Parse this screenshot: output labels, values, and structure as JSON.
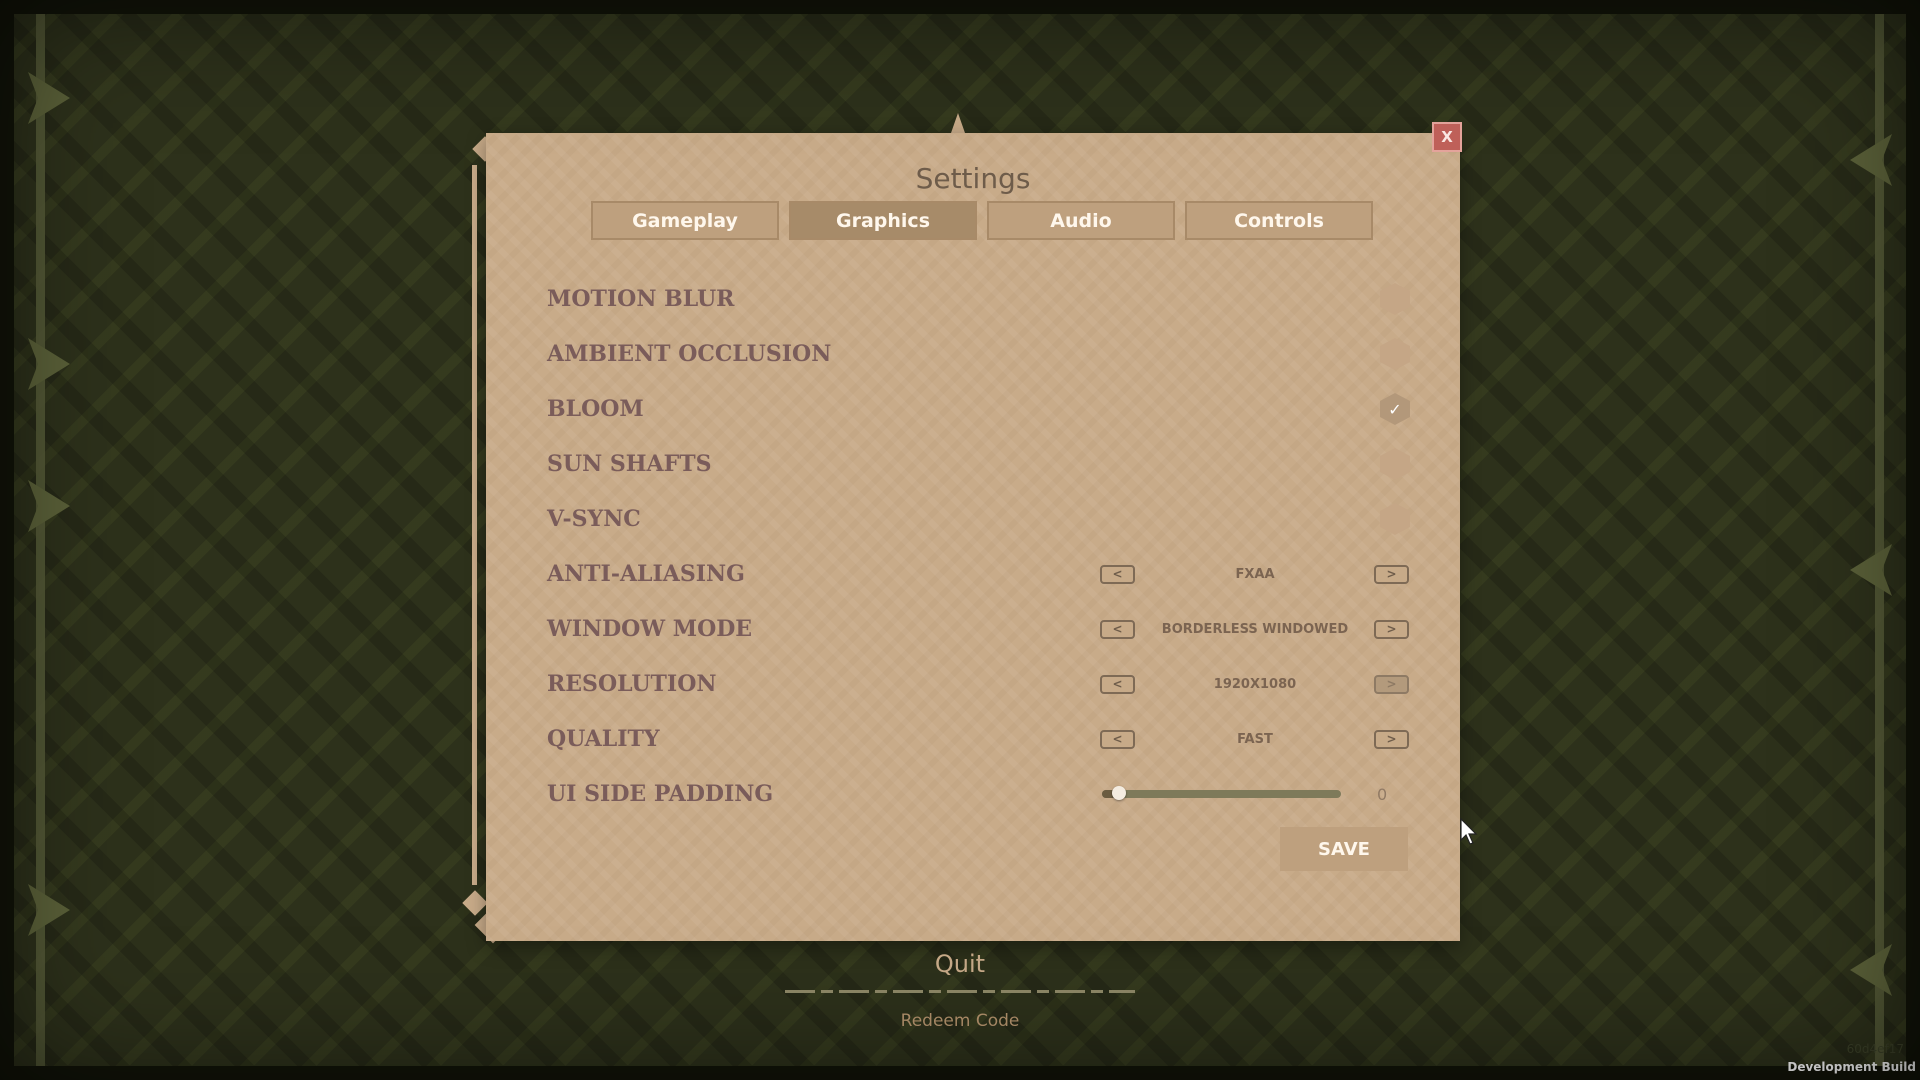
{
  "dialog": {
    "title": "Settings",
    "close_label": "X",
    "tabs": [
      {
        "label": "Gameplay",
        "active": false
      },
      {
        "label": "Graphics",
        "active": true
      },
      {
        "label": "Audio",
        "active": false
      },
      {
        "label": "Controls",
        "active": false
      }
    ],
    "toggles": [
      {
        "label": "MOTION BLUR",
        "checked": false
      },
      {
        "label": "AMBIENT OCCLUSION",
        "checked": false
      },
      {
        "label": "BLOOM",
        "checked": true
      },
      {
        "label": "SUN SHAFTS",
        "checked": false
      },
      {
        "label": "V-SYNC",
        "checked": false
      }
    ],
    "selectors": [
      {
        "label": "ANTI-ALIASING",
        "value": "FXAA",
        "prev": "<",
        "next": ">",
        "next_disabled": false
      },
      {
        "label": "WINDOW MODE",
        "value": "BORDERLESS WINDOWED",
        "prev": "<",
        "next": ">",
        "next_disabled": false
      },
      {
        "label": "RESOLUTION",
        "value": "1920X1080",
        "prev": "<",
        "next": ">",
        "next_disabled": true
      },
      {
        "label": "QUALITY",
        "value": "FAST",
        "prev": "<",
        "next": ">",
        "next_disabled": false
      }
    ],
    "slider": {
      "label": "UI SIDE PADDING",
      "value": "0",
      "fraction": 0.0
    },
    "save_label": "SAVE"
  },
  "menu": {
    "quit_label": "Quit",
    "redeem_label": "Redeem Code"
  },
  "footer": {
    "build_hash": "60d4ef17",
    "dev_build": "Development Build"
  },
  "icons": {
    "check": "check-icon",
    "close": "close-icon",
    "cursor": "mouse-cursor-icon"
  },
  "colors": {
    "background": "#2d311b",
    "panel": "#c8ab89",
    "tab": "#bea07e",
    "tab_active": "#a78b69",
    "label": "#7a5c5a",
    "close": "#c0615a"
  }
}
